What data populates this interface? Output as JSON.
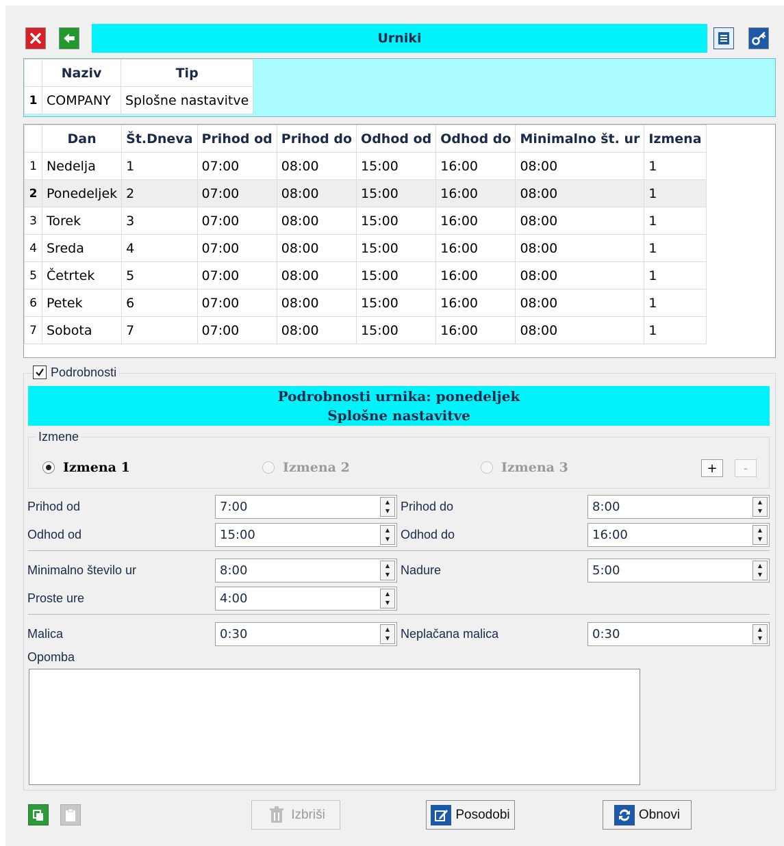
{
  "window": {
    "title": "Urniki"
  },
  "icons": {
    "close": "close-icon",
    "back": "back-arrow-icon",
    "print": "print-icon",
    "key": "key-icon"
  },
  "master": {
    "columns": [
      "Naziv",
      "Tip"
    ],
    "rows": [
      {
        "num": "1",
        "naziv": "COMPANY",
        "tip": "Splošne nastavitve"
      }
    ]
  },
  "days_table": {
    "columns": [
      "Dan",
      "Št.Dneva",
      "Prihod od",
      "Prihod do",
      "Odhod od",
      "Odhod do",
      "Minimalno št. ur",
      "Izmena"
    ],
    "rows": [
      {
        "num": "1",
        "cells": [
          "Nedelja",
          "1",
          "07:00",
          "08:00",
          "15:00",
          "16:00",
          "08:00",
          "1"
        ]
      },
      {
        "num": "2",
        "cells": [
          "Ponedeljek",
          "2",
          "07:00",
          "08:00",
          "15:00",
          "16:00",
          "08:00",
          "1"
        ]
      },
      {
        "num": "3",
        "cells": [
          "Torek",
          "3",
          "07:00",
          "08:00",
          "15:00",
          "16:00",
          "08:00",
          "1"
        ]
      },
      {
        "num": "4",
        "cells": [
          "Sreda",
          "4",
          "07:00",
          "08:00",
          "15:00",
          "16:00",
          "08:00",
          "1"
        ]
      },
      {
        "num": "5",
        "cells": [
          "Četrtek",
          "5",
          "07:00",
          "08:00",
          "15:00",
          "16:00",
          "08:00",
          "1"
        ]
      },
      {
        "num": "6",
        "cells": [
          "Petek",
          "6",
          "07:00",
          "08:00",
          "15:00",
          "16:00",
          "08:00",
          "1"
        ]
      },
      {
        "num": "7",
        "cells": [
          "Sobota",
          "7",
          "07:00",
          "08:00",
          "15:00",
          "16:00",
          "08:00",
          "1"
        ]
      }
    ],
    "selected_row": 1
  },
  "details": {
    "checkbox_label": "Podrobnosti",
    "checked": true,
    "header_line1": "Podrobnosti urnika: ponedeljek",
    "header_line2": "Splošne nastavitve",
    "shifts_group_label": "Izmene",
    "shifts": [
      {
        "label": "Izmena 1",
        "selected": true,
        "enabled": true
      },
      {
        "label": "Izmena 2",
        "selected": false,
        "enabled": false
      },
      {
        "label": "Izmena 3",
        "selected": false,
        "enabled": false
      }
    ],
    "add_label": "+",
    "remove_label": "-",
    "fields": {
      "prihod_od": {
        "label": "Prihod od",
        "value": "7:00"
      },
      "prihod_do": {
        "label": "Prihod do",
        "value": "8:00"
      },
      "odhod_od": {
        "label": "Odhod od",
        "value": "15:00"
      },
      "odhod_do": {
        "label": "Odhod do",
        "value": "16:00"
      },
      "min_ur": {
        "label": "Minimalno število ur",
        "value": "8:00"
      },
      "nadure": {
        "label": "Nadure",
        "value": "5:00"
      },
      "proste_ure": {
        "label": "Proste ure",
        "value": "4:00"
      },
      "malica": {
        "label": "Malica",
        "value": "0:30"
      },
      "neplacana_malica": {
        "label": "Neplačana malica",
        "value": "0:30"
      }
    },
    "opomba_label": "Opomba",
    "opomba_value": ""
  },
  "footer": {
    "izbrisi": "Izbriši",
    "posodobi": "Posodobi",
    "obnovi": "Obnovi"
  },
  "colors": {
    "accent": "#00f2fa",
    "header_panel": "#aafcff",
    "close_red": "#d9202a",
    "back_green": "#1f9a2b",
    "blue_icon": "#1e58a8"
  }
}
